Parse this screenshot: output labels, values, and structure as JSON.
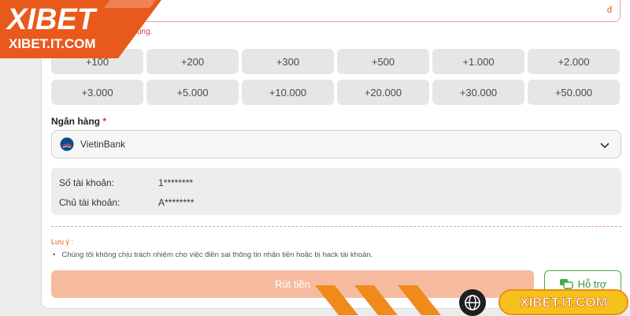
{
  "amount": {
    "unit": "đ",
    "error_text": "ụng."
  },
  "quick_amounts": [
    "+100",
    "+200",
    "+300",
    "+500",
    "+1.000",
    "+2.000",
    "+3.000",
    "+5.000",
    "+10.000",
    "+20.000",
    "+30.000",
    "+50.000"
  ],
  "bank": {
    "label": "Ngân hàng",
    "required_mark": "*",
    "selected": "VietinBank",
    "logo_icon": "vietinbank-logo-icon"
  },
  "account": {
    "number_label": "Số tài khoản:",
    "number_value": "1********",
    "holder_label": "Chủ tài khoản:",
    "holder_value": "A********"
  },
  "note": {
    "title": "Lưu ý :",
    "text": "Chúng tôi không chịu trách nhiệm cho việc điền sai thông tin nhận tiền hoặc bị hack tài khoản."
  },
  "actions": {
    "withdraw_label": "Rút tiền",
    "support_label": "Hỗ trợ",
    "support_icon": "chat-support-icon"
  },
  "branding": {
    "logo_text": "XIBET",
    "logo_domain": "XIBET.IT.COM",
    "footer_domain": "XIBET.IT.COM",
    "globe_icon": "globe-icon"
  },
  "colors": {
    "accent": "#e25a1f",
    "button": "#f6bb9f",
    "support": "#3fae4d",
    "domain_pill": "#f5c21b"
  }
}
